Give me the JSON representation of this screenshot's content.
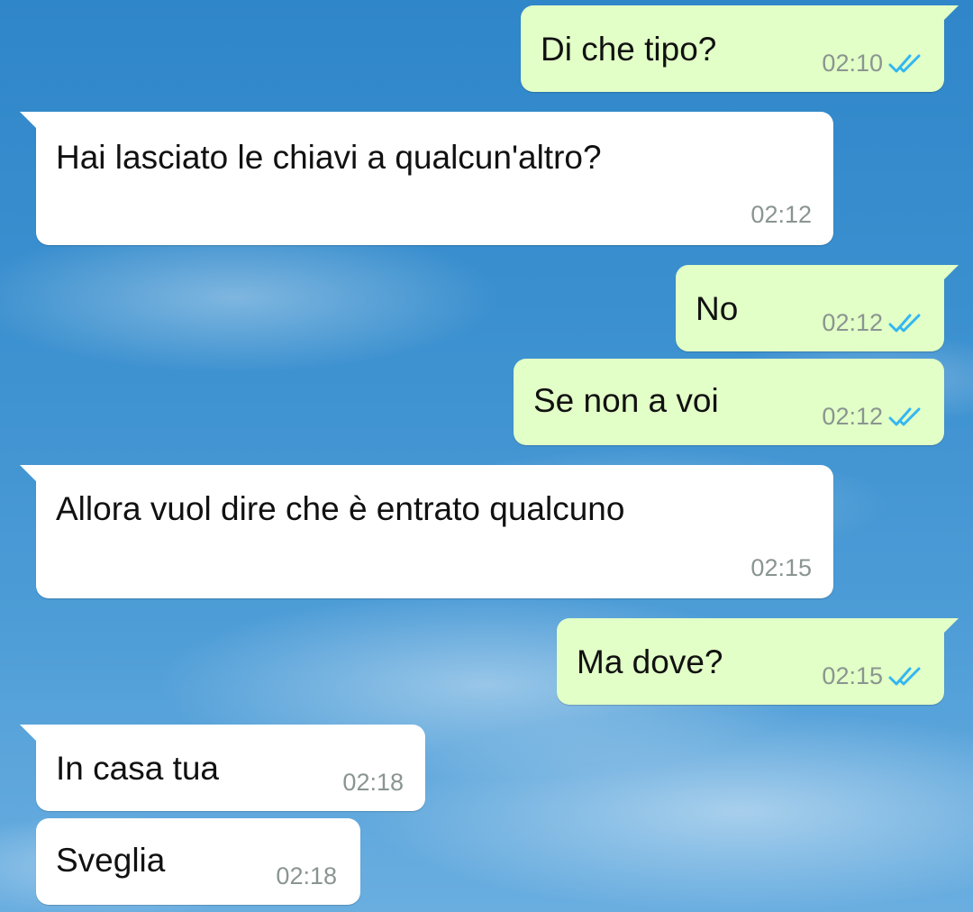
{
  "theme": {
    "outgoing_bubble": "#e2ffc7",
    "incoming_bubble": "#ffffff",
    "read_ticks": "#34b7f1",
    "time_color": "#8a9590"
  },
  "messages": [
    {
      "direction": "outgoing",
      "text": "Di che tipo?",
      "time": "02:10",
      "status_icon": "double-check-read-icon"
    },
    {
      "direction": "incoming",
      "text": "Hai lasciato le chiavi a qualcun'altro?",
      "time": "02:12"
    },
    {
      "direction": "outgoing",
      "text": "No",
      "time": "02:12",
      "status_icon": "double-check-read-icon"
    },
    {
      "direction": "outgoing",
      "text": "Se non a voi",
      "time": "02:12",
      "status_icon": "double-check-read-icon"
    },
    {
      "direction": "incoming",
      "text": "Allora vuol dire che è entrato qualcuno",
      "time": "02:15"
    },
    {
      "direction": "outgoing",
      "text": "Ma dove?",
      "time": "02:15",
      "status_icon": "double-check-read-icon"
    },
    {
      "direction": "incoming",
      "text": "In casa tua",
      "time": "02:18"
    },
    {
      "direction": "incoming",
      "text": "Sveglia",
      "time": "02:18"
    }
  ]
}
